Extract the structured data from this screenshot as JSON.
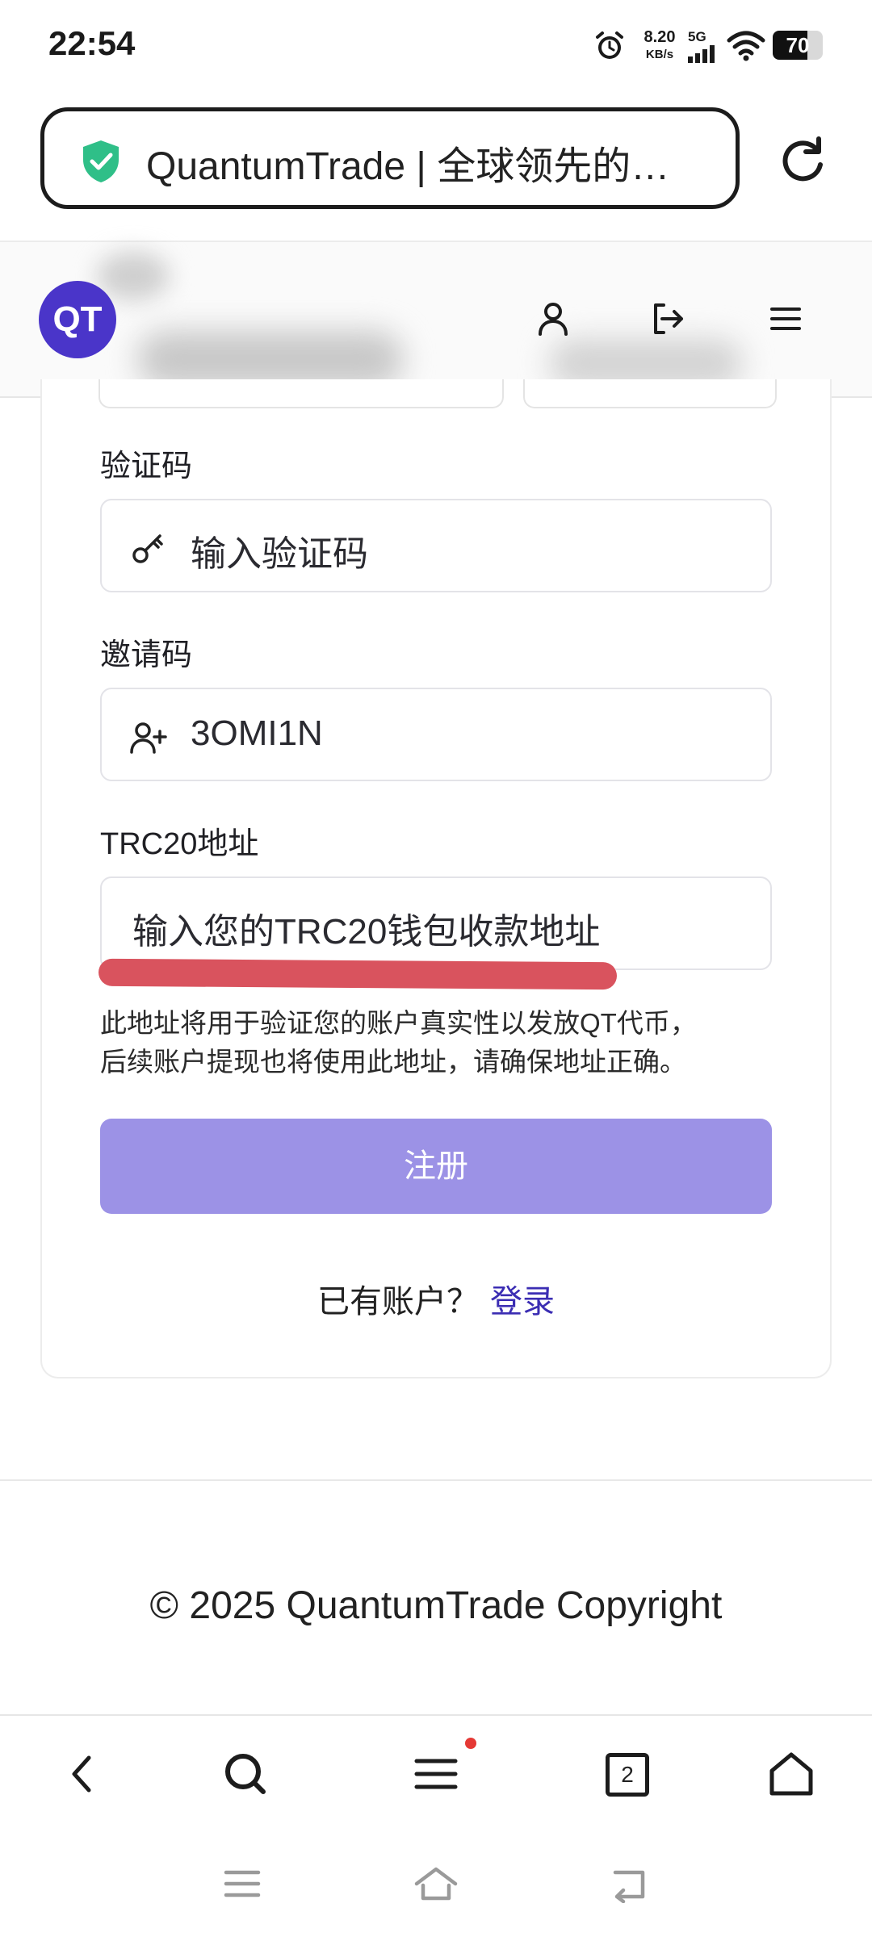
{
  "status_bar": {
    "time": "22:54",
    "net_speed_value": "8.20",
    "net_speed_unit": "KB/s",
    "network_type": "5G",
    "battery_level": "70"
  },
  "browser": {
    "page_title": "QuantumTrade | 全球领先的…",
    "tabs_count": "2"
  },
  "site": {
    "logo_text": "QT"
  },
  "form": {
    "captcha_label": "验证码",
    "captcha_placeholder": "输入验证码",
    "invite_label": "邀请码",
    "invite_value": "3OMI1N",
    "trc20_label": "TRC20地址",
    "trc20_placeholder": "输入您的TRC20钱包收款地址",
    "note_line1": "此地址将用于验证您的账户真实性以发放QT代币，",
    "note_line2": "后续账户提现也将使用此地址，请确保地址正确。",
    "submit_label": "注册",
    "have_account": "已有账户？",
    "login_link": "登录"
  },
  "footer": {
    "copyright": "© 2025 QuantumTrade Copyright"
  },
  "colors": {
    "brand": "#4a35c9",
    "button": "#9c92e6",
    "link": "#3b2db3",
    "annotation": "#d9535e",
    "shield": "#2fbf88"
  },
  "icons": [
    "alarm-icon",
    "signal-icon",
    "wifi-icon",
    "shield-icon",
    "reload-icon",
    "user-icon",
    "logout-icon",
    "hamburger-icon",
    "key-icon",
    "user-plus-icon",
    "back-icon",
    "search-icon",
    "menu-icon",
    "tabs-icon",
    "home-icon",
    "sys-menu-icon",
    "sys-home-icon",
    "sys-back-icon"
  ]
}
